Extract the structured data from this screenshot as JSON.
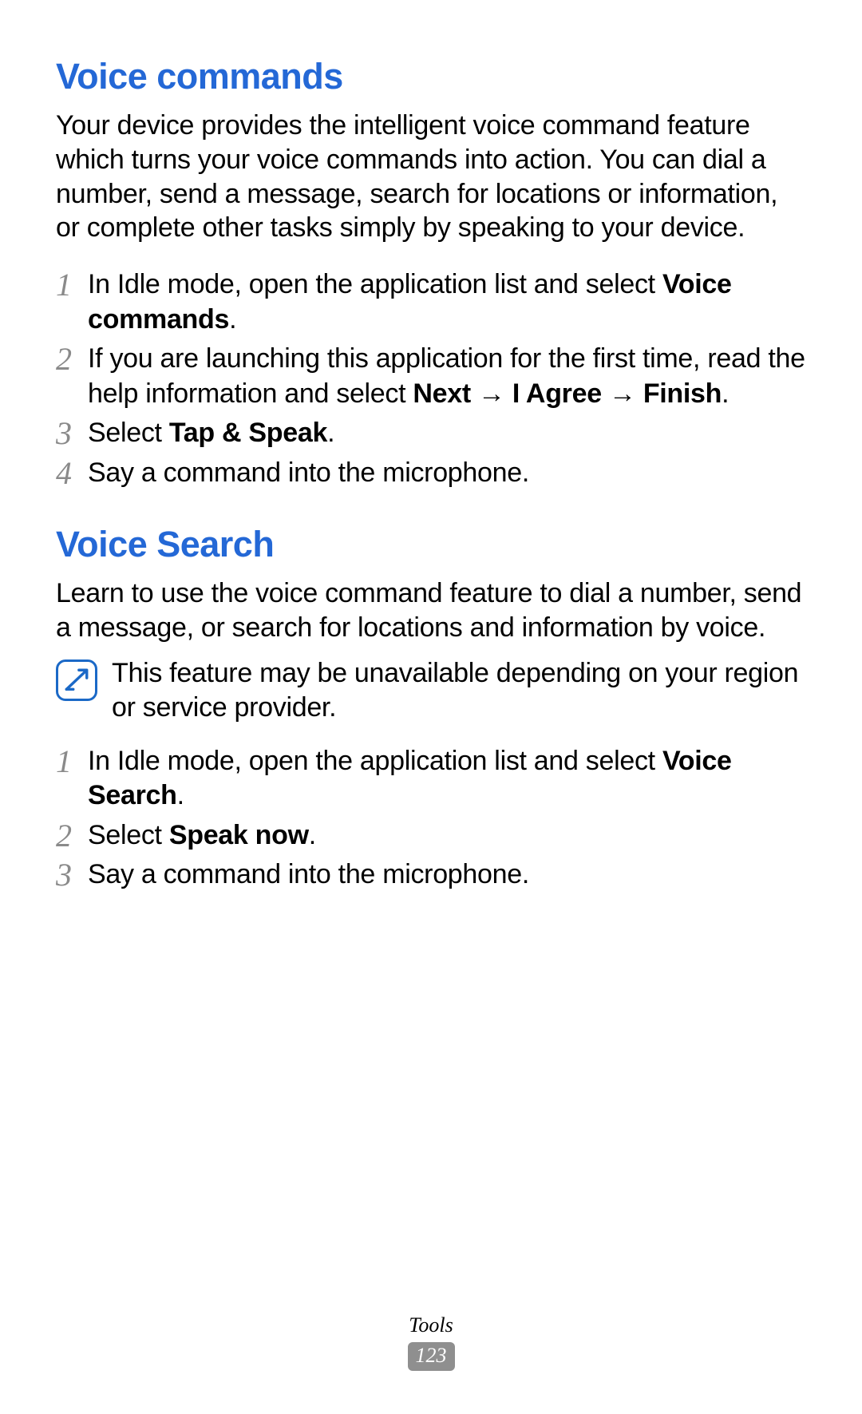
{
  "section1": {
    "heading": "Voice commands",
    "intro": "Your device provides the intelligent voice command feature which turns your voice commands into action. You can dial a number, send a message, search for locations or information, or complete other tasks simply by speaking to your device.",
    "steps": [
      {
        "num": "1",
        "pre": "In Idle mode, open the application list and select ",
        "b1": "Voice commands",
        "post": "."
      },
      {
        "num": "2",
        "pre": "If you are launching this application for the first time, read the help information and select ",
        "b1": "Next",
        "mid1": " → ",
        "b2": "I Agree",
        "mid2": " → ",
        "b3": "Finish",
        "post": "."
      },
      {
        "num": "3",
        "pre": "Select ",
        "b1": "Tap & Speak",
        "post": "."
      },
      {
        "num": "4",
        "pre": "Say a command into the microphone."
      }
    ]
  },
  "section2": {
    "heading": "Voice Search",
    "intro": "Learn to use the voice command feature to dial a number, send a message, or search for locations and information by voice.",
    "note": "This feature may be unavailable depending on your region or service provider.",
    "steps": [
      {
        "num": "1",
        "pre": "In Idle mode, open the application list and select ",
        "b1": "Voice Search",
        "post": "."
      },
      {
        "num": "2",
        "pre": "Select ",
        "b1": "Speak now",
        "post": "."
      },
      {
        "num": "3",
        "pre": "Say a command into the microphone."
      }
    ]
  },
  "footer": {
    "section": "Tools",
    "page": "123"
  }
}
